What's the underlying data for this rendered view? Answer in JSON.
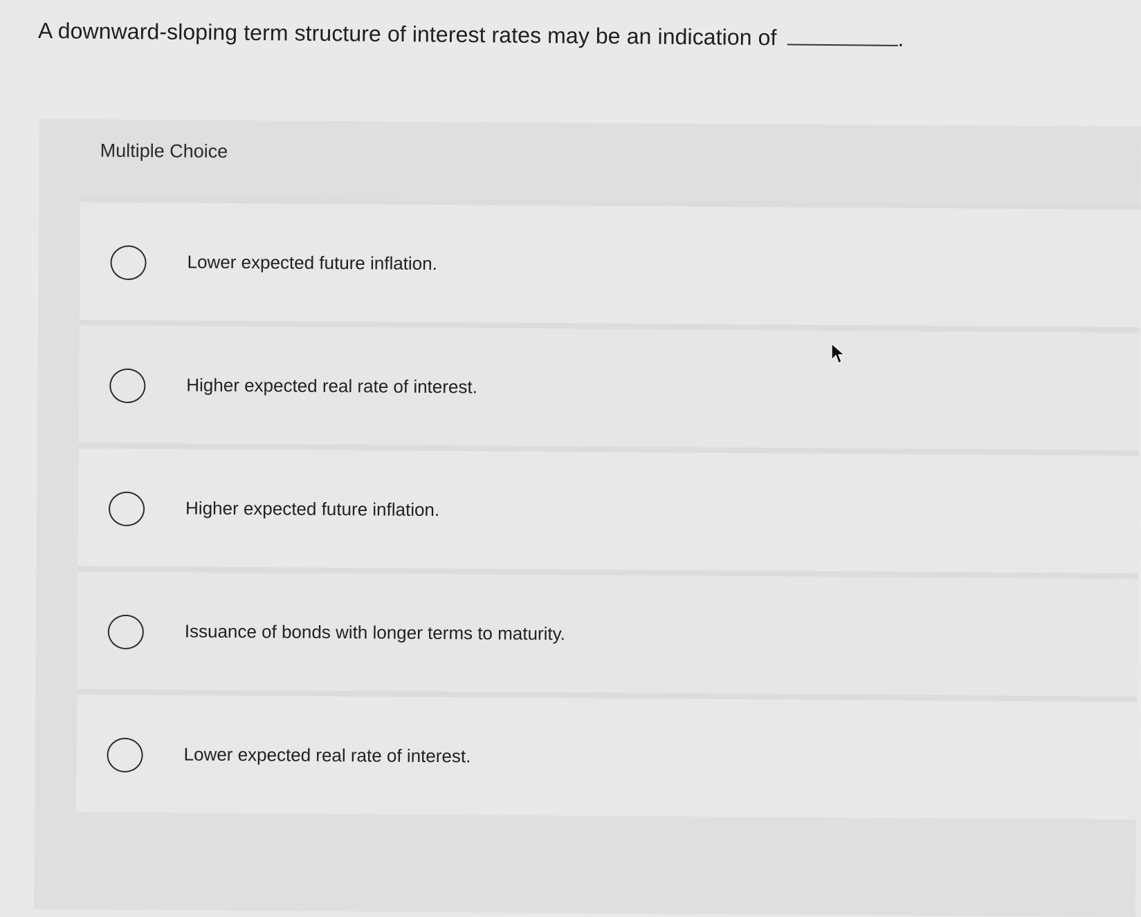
{
  "question": {
    "text": "A downward-sloping term structure of interest rates may be an indication of",
    "end_punct": "."
  },
  "panel": {
    "title": "Multiple Choice"
  },
  "choices": [
    {
      "label": "Lower expected future inflation."
    },
    {
      "label": "Higher expected real rate of interest."
    },
    {
      "label": "Higher expected future inflation."
    },
    {
      "label": "Issuance of bonds with longer terms to maturity."
    },
    {
      "label": "Lower expected real rate of interest."
    }
  ],
  "icons": {
    "radio": "radio-unselected-icon",
    "cursor": "mouse-pointer-icon"
  }
}
